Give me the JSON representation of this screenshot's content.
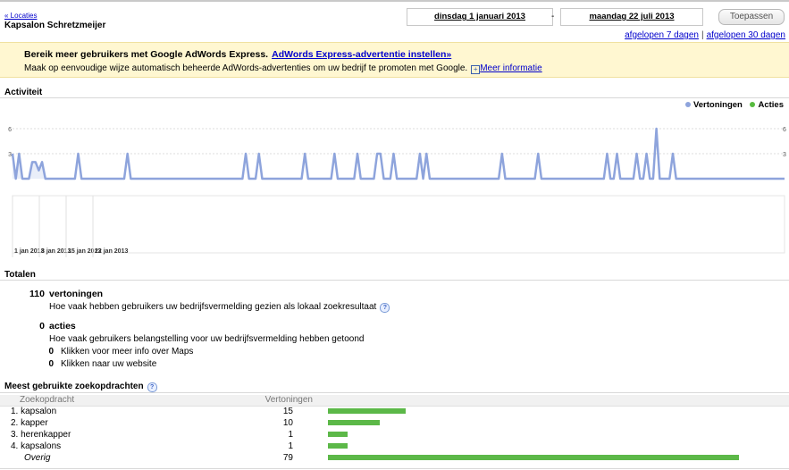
{
  "header": {
    "back_link": "« Locaties",
    "business_name": "Kapsalon Schretzmeijer",
    "start_date": "dinsdag 1 januari 2013",
    "date_separator": "-",
    "end_date": "maandag 22 juli 2013",
    "apply_label": "Toepassen",
    "quick_ranges": [
      "afgelopen 7 dagen",
      "afgelopen 30 dagen"
    ],
    "quick_separator": "|"
  },
  "promo": {
    "title": "Bereik meer gebruikers met Google AdWords Express.",
    "title_link": "AdWords Express-advertentie instellen»",
    "text": "Maak op eenvoudige wijze automatisch beheerde AdWords-advertenties om uw bedrijf te promoten met Google.",
    "more_icon": "+",
    "more_link": "Meer informatie"
  },
  "activity": {
    "title": "Activiteit",
    "legend": [
      {
        "label": "Vertoningen",
        "color": "#8ea4dc"
      },
      {
        "label": "Acties",
        "color": "#57bb3f"
      }
    ]
  },
  "chart_data": {
    "type": "line",
    "y_tick_labels": [
      "6",
      "3"
    ],
    "ylim": [
      0,
      6
    ],
    "x_tick_labels": [
      "1 jan 2013",
      "8 jan 2013",
      "15 jan 2013",
      "22 jan 2013"
    ],
    "series": [
      {
        "name": "Vertoningen",
        "color": "#8ea4dc",
        "values": [
          3,
          0,
          3,
          0,
          0,
          0,
          2,
          2,
          1,
          2,
          0,
          0,
          0,
          0,
          0,
          0,
          0,
          0,
          0,
          0,
          3,
          0,
          0,
          0,
          0,
          0,
          0,
          0,
          0,
          0,
          0,
          0,
          0,
          0,
          0,
          3,
          0,
          0,
          0,
          0,
          0,
          0,
          0,
          0,
          0,
          0,
          0,
          0,
          0,
          0,
          0,
          0,
          0,
          0,
          0,
          0,
          0,
          0,
          0,
          0,
          0,
          0,
          0,
          0,
          0,
          0,
          0,
          0,
          0,
          0,
          0,
          3,
          0,
          0,
          0,
          3,
          0,
          0,
          0,
          0,
          0,
          0,
          0,
          0,
          0,
          0,
          0,
          0,
          0,
          3,
          0,
          0,
          0,
          0,
          0,
          0,
          0,
          0,
          3,
          0,
          0,
          0,
          0,
          0,
          0,
          3,
          0,
          0,
          0,
          0,
          0,
          3,
          3,
          0,
          0,
          0,
          3,
          0,
          0,
          0,
          0,
          0,
          0,
          0,
          3,
          0,
          3,
          0,
          0,
          0,
          0,
          0,
          0,
          0,
          0,
          0,
          0,
          0,
          0,
          0,
          0,
          0,
          0,
          0,
          0,
          0,
          0,
          0,
          0,
          3,
          0,
          0,
          0,
          0,
          0,
          0,
          0,
          0,
          0,
          0,
          3,
          0,
          0,
          0,
          0,
          0,
          0,
          0,
          0,
          0,
          0,
          0,
          0,
          0,
          0,
          0,
          0,
          0,
          0,
          0,
          0,
          3,
          0,
          0,
          3,
          0,
          0,
          0,
          0,
          0,
          3,
          0,
          0,
          3,
          0,
          0,
          6,
          0,
          0,
          0,
          0,
          3,
          0,
          0,
          0,
          0,
          0,
          0,
          0,
          0,
          0,
          0,
          0,
          0,
          0,
          0,
          0,
          0,
          0,
          0,
          0,
          0,
          0,
          0,
          0,
          0,
          0,
          0,
          0,
          0,
          0,
          0,
          0,
          0,
          0,
          0
        ]
      },
      {
        "name": "Acties",
        "color": "#57bb3f",
        "values": [
          0,
          0,
          0,
          0,
          0,
          0,
          0,
          0,
          0,
          0,
          0,
          0,
          0,
          0,
          0,
          0,
          0,
          0,
          0,
          0,
          0,
          0,
          0,
          0,
          0,
          0,
          0,
          0,
          0,
          0,
          0,
          0,
          0,
          0,
          0,
          0,
          0,
          0,
          0,
          0,
          0,
          0,
          0,
          0,
          0,
          0,
          0,
          0,
          0,
          0,
          0,
          0,
          0,
          0,
          0,
          0,
          0,
          0,
          0,
          0,
          0,
          0,
          0,
          0,
          0,
          0,
          0,
          0,
          0,
          0,
          0,
          0,
          0,
          0,
          0,
          0,
          0,
          0,
          0,
          0,
          0,
          0,
          0,
          0,
          0,
          0,
          0,
          0,
          0,
          0,
          0,
          0,
          0,
          0,
          0,
          0,
          0,
          0,
          0,
          0,
          0,
          0,
          0,
          0,
          0,
          0,
          0,
          0,
          0,
          0,
          0,
          0,
          0,
          0,
          0,
          0,
          0,
          0,
          0,
          0,
          0,
          0,
          0,
          0,
          0,
          0,
          0,
          0,
          0,
          0,
          0,
          0,
          0,
          0,
          0,
          0,
          0,
          0,
          0,
          0,
          0,
          0,
          0,
          0,
          0,
          0,
          0,
          0,
          0,
          0,
          0,
          0,
          0,
          0,
          0,
          0,
          0,
          0,
          0,
          0,
          0,
          0,
          0,
          0,
          0,
          0,
          0,
          0,
          0,
          0,
          0,
          0,
          0,
          0,
          0,
          0,
          0,
          0,
          0,
          0,
          0,
          0,
          0,
          0,
          0,
          0,
          0,
          0,
          0,
          0,
          0,
          0,
          0,
          0,
          0,
          0,
          0,
          0,
          0,
          0,
          0,
          0,
          0,
          0,
          0,
          0,
          0,
          0,
          0,
          0,
          0,
          0,
          0,
          0,
          0,
          0,
          0,
          0,
          0,
          0,
          0,
          0,
          0,
          0,
          0,
          0,
          0,
          0
        ]
      }
    ]
  },
  "totals": {
    "title": "Totalen",
    "impressions_value": "110",
    "impressions_label": "vertoningen",
    "impressions_desc": "Hoe vaak hebben gebruikers uw bedrijfsvermelding gezien als lokaal zoekresultaat",
    "actions_value": "0",
    "actions_label": "acties",
    "actions_desc": "Hoe vaak gebruikers belangstelling voor uw bedrijfsvermelding hebben getoond",
    "sub": [
      {
        "value": "0",
        "label": "Klikken voor meer info over Maps"
      },
      {
        "value": "0",
        "label": "Klikken naar uw website"
      }
    ]
  },
  "queries": {
    "title": "Meest gebruikte zoekopdrachten",
    "col_query": "Zoekopdracht",
    "col_impressions": "Vertoningen",
    "max_value": 79,
    "rows": [
      {
        "name": "1. kapsalon",
        "value": 15
      },
      {
        "name": "2. kapper",
        "value": 10
      },
      {
        "name": "3. herenkapper",
        "value": 1
      },
      {
        "name": "4. kapsalons",
        "value": 1
      },
      {
        "name": "Overig",
        "value": 79
      }
    ]
  },
  "help_icon": "?"
}
